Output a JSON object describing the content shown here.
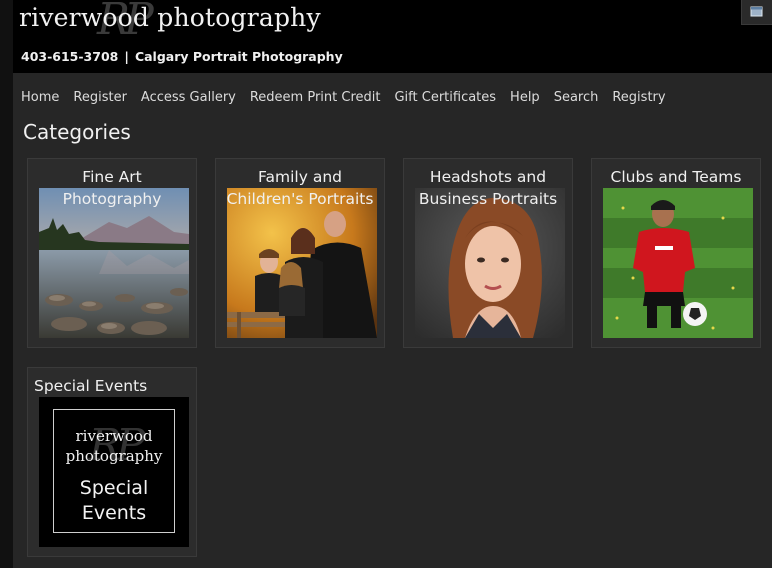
{
  "header": {
    "logo_text": "riverwood photography",
    "logo_monogram": "RP",
    "phone": "403-615-3708",
    "separator": "|",
    "subtitle": "Calgary Portrait Photography"
  },
  "nav": {
    "items": [
      "Home",
      "Register",
      "Access Gallery",
      "Redeem Print Credit",
      "Gift Certificates",
      "Help",
      "Search",
      "Registry"
    ]
  },
  "page": {
    "title": "Categories"
  },
  "categories": [
    {
      "title_line1": "Fine Art",
      "title_line2": "Photography"
    },
    {
      "title_line1": "Family and",
      "title_line2": "Children's Portraits"
    },
    {
      "title_line1": "Headshots and",
      "title_line2": "Business Portraits"
    },
    {
      "title_line1": "Clubs and Teams",
      "title_line2": ""
    },
    {
      "title_line1": "Special Events",
      "title_line2": "",
      "thumb_logo": "riverwood photography",
      "thumb_line1": "Special",
      "thumb_line2": "Events"
    }
  ],
  "icons": {
    "corner": "window-icon"
  }
}
